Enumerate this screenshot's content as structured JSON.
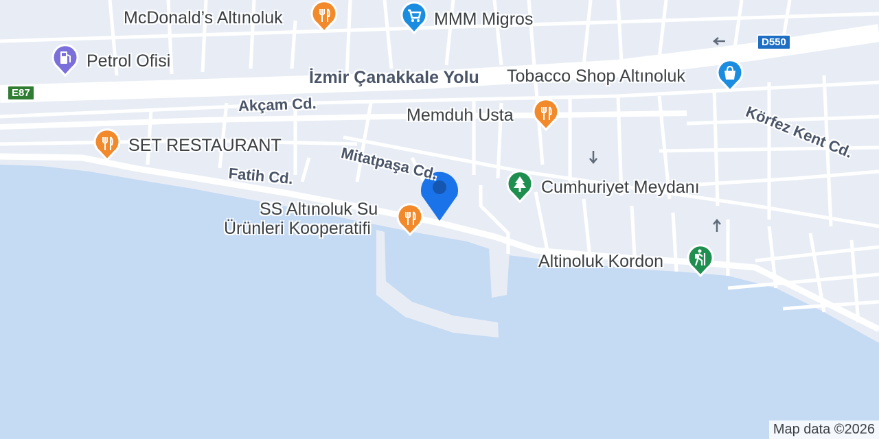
{
  "colors": {
    "water": "#c5daf3",
    "land": "#e8edf5",
    "road": "#ffffff",
    "restaurant": "#f28a2c",
    "shop": "#1a8de0",
    "fuel": "#7b6fdb",
    "park": "#1e8f4e",
    "location": "#1a73e8"
  },
  "road_labels": {
    "izmir": "İzmir Çanakkale Yolu",
    "akcam": "Akçam Cd.",
    "mitatpasa": "Mitatpaşa Cd.",
    "fatih": "Fatih Cd.",
    "korfez": "Körfez Kent Cd."
  },
  "shields": {
    "e87": "E87",
    "d550": "D550"
  },
  "pois": [
    {
      "name": "McDonald’s Altınoluk",
      "icon": "restaurant-icon",
      "color": "#f28a2c"
    },
    {
      "name": "MMM Migros",
      "icon": "shopping-cart-icon",
      "color": "#1a8de0"
    },
    {
      "name": "Petrol Ofisi",
      "icon": "gas-station-icon",
      "color": "#7b6fdb"
    },
    {
      "name": "Tobacco Shop Altınoluk",
      "icon": "shopping-bag-icon",
      "color": "#1a8de0"
    },
    {
      "name": "Memduh Usta",
      "icon": "restaurant-icon",
      "color": "#f28a2c"
    },
    {
      "name": "SET RESTAURANT",
      "icon": "restaurant-icon",
      "color": "#f28a2c"
    },
    {
      "name": "Cumhuriyet Meydanı",
      "icon": "tree-icon",
      "color": "#1e8f4e"
    },
    {
      "name": "SS Altınoluk Su Ürünleri Kooperatifi",
      "line1": "SS Altınoluk Su",
      "line2": "Ürünleri Kooperatifi",
      "icon": "restaurant-icon",
      "color": "#f28a2c"
    },
    {
      "name": "Altinoluk Kordon",
      "icon": "hiking-icon",
      "color": "#1e8f4e"
    }
  ],
  "attribution": "Map data ©2026"
}
